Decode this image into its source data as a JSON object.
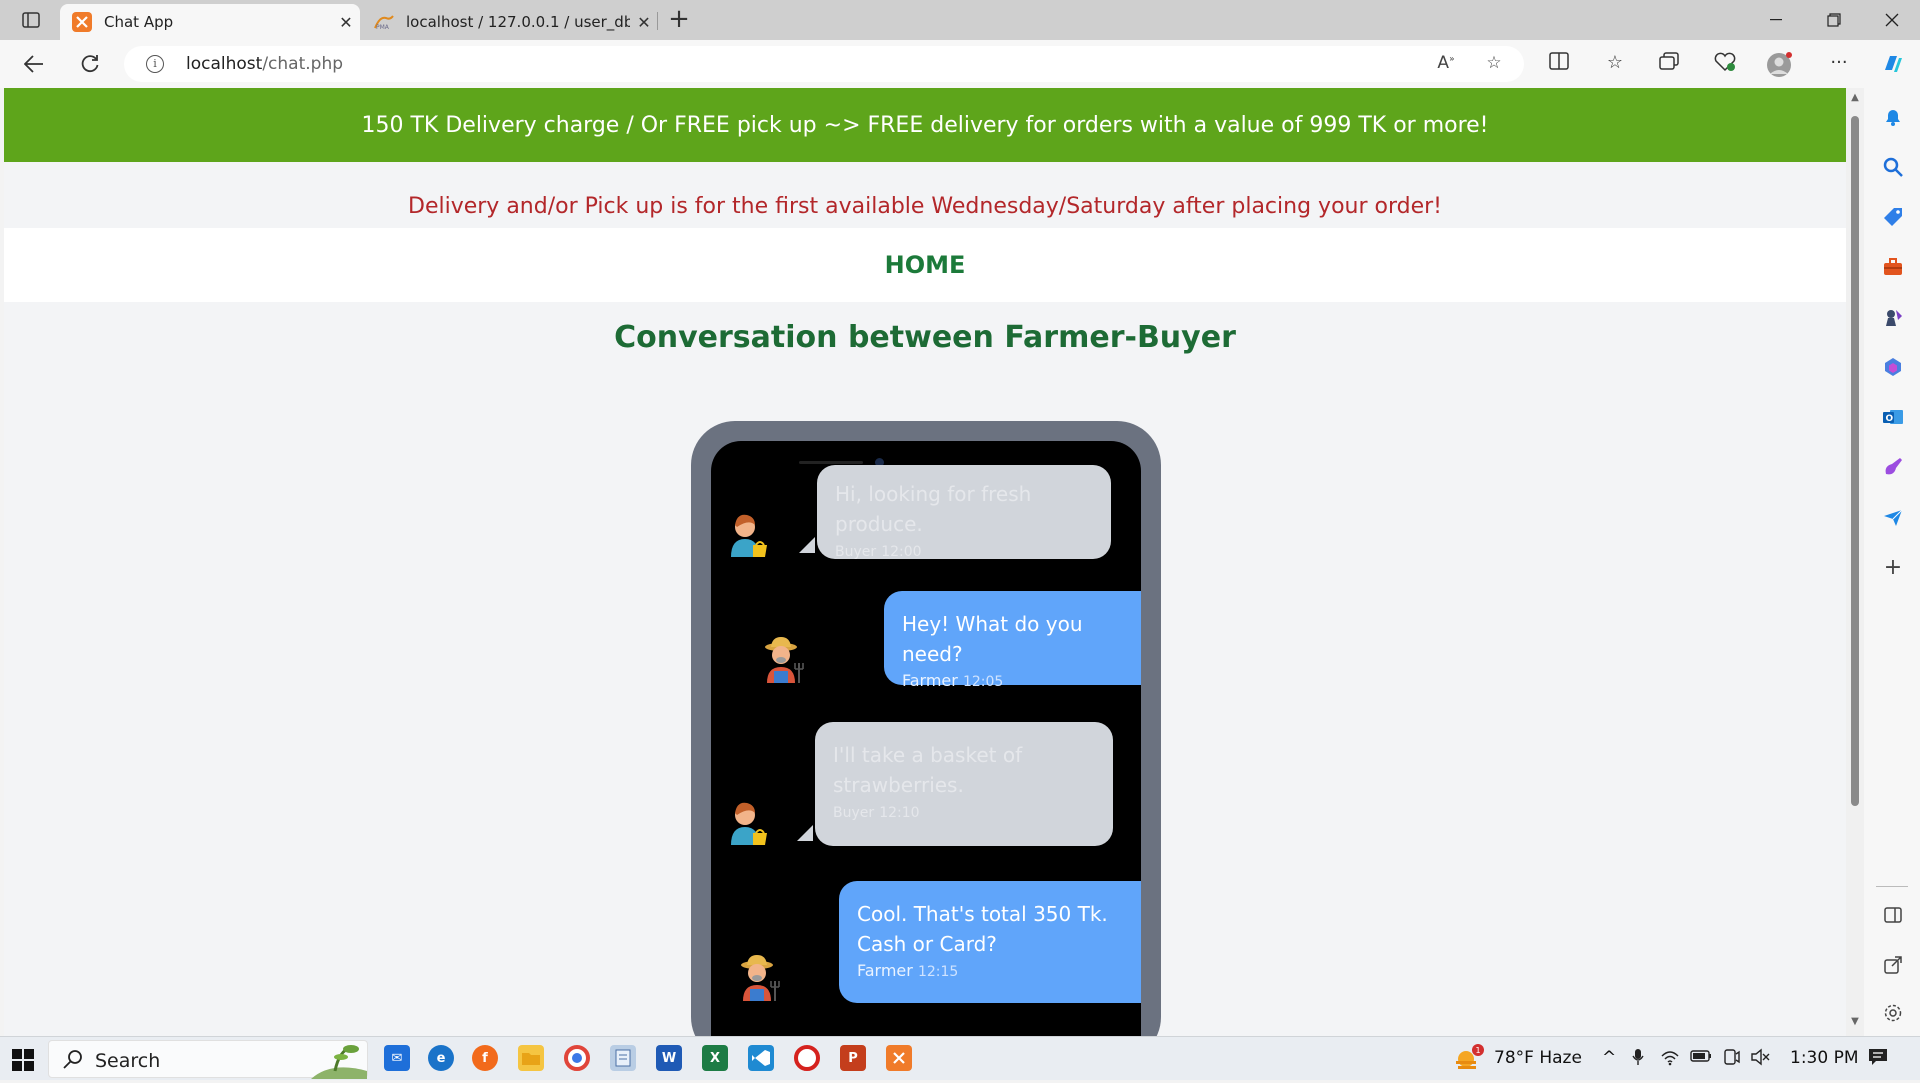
{
  "browser": {
    "tabs": [
      {
        "title": "Chat App",
        "active": true
      },
      {
        "title": "localhost / 127.0.0.1 / user_db / u",
        "active": false
      }
    ],
    "url_host": "localhost",
    "url_path": "/chat.php"
  },
  "page": {
    "banner": "150 TK Delivery charge / Or FREE pick up ~> FREE delivery for orders with a value of 999 TK or more!",
    "notice": "Delivery and/or Pick up is for the first available Wednesday/Saturday after placing your order!",
    "home_link": "HOME",
    "title": "Conversation between Farmer-Buyer"
  },
  "chat": {
    "messages": [
      {
        "role": "buyer",
        "text": "Hi, looking for fresh produce.",
        "sender": "Buyer",
        "time": "12:00"
      },
      {
        "role": "farmer",
        "text": "Hey! What do you need?",
        "sender": "Farmer",
        "time": "12:05"
      },
      {
        "role": "buyer",
        "text_line1": "I'll take a basket of",
        "text_line2": "strawberries.",
        "sender": "Buyer",
        "time": "12:10"
      },
      {
        "role": "farmer",
        "text_line1": "Cool. That's total 350 Tk.",
        "text_line2": "Cash or Card?",
        "sender": "Farmer",
        "time": "12:15"
      }
    ]
  },
  "taskbar": {
    "search_label": "Search",
    "weather": "78°F  Haze",
    "clock": "1:30 PM"
  },
  "colors": {
    "banner": "#5ea51b",
    "notice": "#b3272a",
    "heading": "#1d6b35",
    "farmer_bubble": "#60a5fa",
    "buyer_bubble": "#d1d5db"
  }
}
